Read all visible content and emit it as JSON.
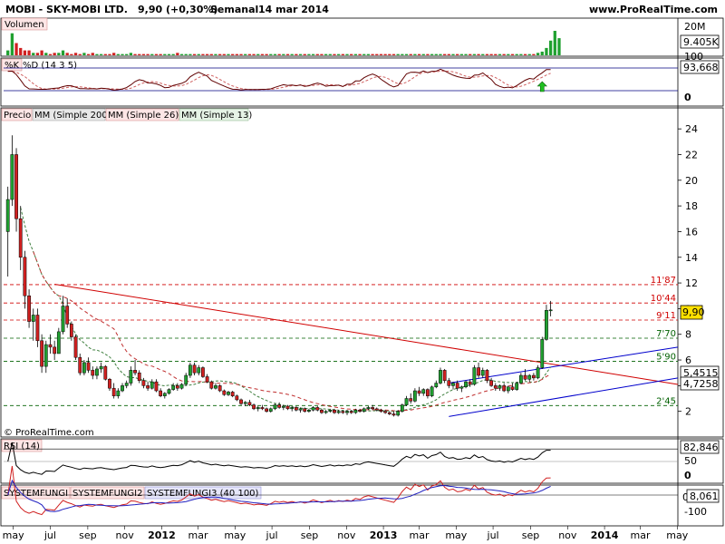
{
  "header": {
    "ticker": "MOBI - SKY-MOBI LTD.",
    "price_change": "9,90 (+0,30%)",
    "period": "Semanal",
    "date": "14 mar 2014",
    "site": "www.ProRealTime.com"
  },
  "colors": {
    "up": "#20a030",
    "down": "#d02020",
    "resistance": "#d00000",
    "support": "#006000",
    "channel": "#0000cc",
    "sma200": "#555555",
    "sma26": "#c03030",
    "sma13": "#408040"
  },
  "volume_panel": {
    "title": "Volumen",
    "axis_labels": [
      "20M",
      "9.405K"
    ]
  },
  "stoch_panel": {
    "k_label": "%K",
    "d_label": "%D (14 3 5)",
    "axis_labels": [
      "100",
      "93,668",
      "0"
    ],
    "arrow_icon": "up-arrow-icon"
  },
  "price_panel": {
    "legend": [
      "Precio",
      "MM (Simple 200)",
      "MM (Simple 26)",
      "MM (Simple 13)"
    ],
    "copyright": "© ProRealTime.com",
    "level_labels": [
      "11'87",
      "10'44",
      "9'11",
      "7'70",
      "5'90",
      "2'45"
    ],
    "current_price": "9,90",
    "sma_13_value": "5,4515",
    "sma_26_value": "4,7258"
  },
  "rsi_panel": {
    "title": "RSI (14)",
    "axis_labels": [
      "82,846",
      "50",
      "0"
    ]
  },
  "sf_panel": {
    "titles": [
      "SYSTEMFUNGI",
      "SYSTEMFUNGI2",
      "SYSTEMFUNGI3 (40 100)"
    ],
    "axis_labels": [
      "0",
      "8,061",
      "-100"
    ]
  },
  "x_axis": {
    "labels": [
      "may",
      "jul",
      "sep",
      "nov",
      "2012",
      "mar",
      "may",
      "jul",
      "sep",
      "nov",
      "2013",
      "mar",
      "may",
      "jul",
      "sep",
      "nov",
      "2014",
      "mar",
      "may"
    ]
  },
  "chart_data": {
    "type": "candlestick",
    "frequency": "Semanal",
    "y_axis_ticks": [
      2,
      4,
      6,
      8,
      10,
      12,
      14,
      16,
      18,
      20,
      22,
      24
    ],
    "ylim": [
      0,
      25
    ],
    "xlim": [
      "2011-05-06",
      "2014-05-23"
    ],
    "horizontal_levels": [
      {
        "label": "11'87",
        "value": 11.87,
        "style": "resistance"
      },
      {
        "label": "10'44",
        "value": 10.44,
        "style": "resistance"
      },
      {
        "label": "9'11",
        "value": 9.11,
        "style": "resistance"
      },
      {
        "label": "7'70",
        "value": 7.7,
        "style": "support"
      },
      {
        "label": "5'90",
        "value": 5.9,
        "style": "support"
      },
      {
        "label": "2'45",
        "value": 2.45,
        "style": "support"
      }
    ],
    "trendlines": [
      {
        "name": "",
        "from": {
          "date": "2011-07-29",
          "value": 11.9
        },
        "to": {
          "date": "2014-05-23",
          "value": 4.1
        },
        "color": "resistance"
      },
      {
        "name": "",
        "from": {
          "date": "2013-05-10",
          "value": 4.2
        },
        "to": {
          "date": "2014-05-23",
          "value": 7.0
        },
        "color": "channel"
      },
      {
        "name": "",
        "from": {
          "date": "2013-05-10",
          "value": 1.6
        },
        "to": {
          "date": "2014-05-23",
          "value": 4.6
        },
        "color": "channel"
      }
    ],
    "candles": [
      {
        "o": 16.0,
        "h": 19.5,
        "l": 12.5,
        "c": 18.5
      },
      {
        "o": 18.5,
        "h": 23.5,
        "l": 18.0,
        "c": 22.0
      },
      {
        "o": 22.0,
        "h": 22.5,
        "l": 16.0,
        "c": 17.0
      },
      {
        "o": 17.0,
        "h": 18.0,
        "l": 13.0,
        "c": 14.0
      },
      {
        "o": 14.0,
        "h": 14.5,
        "l": 10.0,
        "c": 11.0
      },
      {
        "o": 11.0,
        "h": 11.5,
        "l": 8.5,
        "c": 9.0
      },
      {
        "o": 9.0,
        "h": 10.0,
        "l": 7.5,
        "c": 9.5
      },
      {
        "o": 9.5,
        "h": 10.0,
        "l": 7.0,
        "c": 7.5
      },
      {
        "o": 7.5,
        "h": 8.0,
        "l": 5.0,
        "c": 5.5
      },
      {
        "o": 5.5,
        "h": 7.5,
        "l": 5.0,
        "c": 7.2
      },
      {
        "o": 7.2,
        "h": 8.0,
        "l": 6.5,
        "c": 7.0
      },
      {
        "o": 7.0,
        "h": 7.5,
        "l": 6.0,
        "c": 6.5
      },
      {
        "o": 6.5,
        "h": 8.5,
        "l": 6.5,
        "c": 8.2
      },
      {
        "o": 8.2,
        "h": 11.0,
        "l": 8.0,
        "c": 10.2
      },
      {
        "o": 10.2,
        "h": 10.8,
        "l": 8.5,
        "c": 8.8
      },
      {
        "o": 8.8,
        "h": 9.0,
        "l": 7.5,
        "c": 7.8
      },
      {
        "o": 7.8,
        "h": 8.0,
        "l": 6.0,
        "c": 6.2
      },
      {
        "o": 6.2,
        "h": 6.5,
        "l": 4.8,
        "c": 5.0
      },
      {
        "o": 5.0,
        "h": 6.0,
        "l": 4.8,
        "c": 5.8
      },
      {
        "o": 5.8,
        "h": 6.2,
        "l": 5.0,
        "c": 5.2
      },
      {
        "o": 5.2,
        "h": 5.5,
        "l": 4.5,
        "c": 4.8
      },
      {
        "o": 4.8,
        "h": 5.5,
        "l": 4.5,
        "c": 5.3
      },
      {
        "o": 5.3,
        "h": 5.8,
        "l": 5.0,
        "c": 5.5
      },
      {
        "o": 5.5,
        "h": 5.6,
        "l": 4.4,
        "c": 4.5
      },
      {
        "o": 4.5,
        "h": 4.6,
        "l": 3.6,
        "c": 3.8
      },
      {
        "o": 3.8,
        "h": 4.2,
        "l": 3.0,
        "c": 3.2
      },
      {
        "o": 3.2,
        "h": 3.8,
        "l": 3.0,
        "c": 3.6
      },
      {
        "o": 3.6,
        "h": 4.2,
        "l": 3.5,
        "c": 4.0
      },
      {
        "o": 4.0,
        "h": 4.4,
        "l": 3.8,
        "c": 4.2
      },
      {
        "o": 4.2,
        "h": 5.5,
        "l": 4.0,
        "c": 5.2
      },
      {
        "o": 5.2,
        "h": 6.0,
        "l": 4.8,
        "c": 5.0
      },
      {
        "o": 5.0,
        "h": 5.2,
        "l": 4.2,
        "c": 4.4
      },
      {
        "o": 4.4,
        "h": 4.6,
        "l": 3.8,
        "c": 4.0
      },
      {
        "o": 4.0,
        "h": 4.3,
        "l": 3.6,
        "c": 3.8
      },
      {
        "o": 3.8,
        "h": 4.5,
        "l": 3.7,
        "c": 4.3
      },
      {
        "o": 4.3,
        "h": 4.5,
        "l": 3.5,
        "c": 3.6
      },
      {
        "o": 3.6,
        "h": 3.8,
        "l": 3.1,
        "c": 3.2
      },
      {
        "o": 3.2,
        "h": 3.5,
        "l": 3.0,
        "c": 3.4
      },
      {
        "o": 3.4,
        "h": 3.8,
        "l": 3.3,
        "c": 3.7
      },
      {
        "o": 3.7,
        "h": 4.2,
        "l": 3.6,
        "c": 4.0
      },
      {
        "o": 4.0,
        "h": 4.2,
        "l": 3.6,
        "c": 3.8
      },
      {
        "o": 3.8,
        "h": 4.2,
        "l": 3.7,
        "c": 4.1
      },
      {
        "o": 4.1,
        "h": 5.0,
        "l": 4.0,
        "c": 4.8
      },
      {
        "o": 4.8,
        "h": 5.8,
        "l": 4.6,
        "c": 5.6
      },
      {
        "o": 5.6,
        "h": 5.8,
        "l": 4.8,
        "c": 5.0
      },
      {
        "o": 5.0,
        "h": 5.6,
        "l": 4.8,
        "c": 5.4
      },
      {
        "o": 5.4,
        "h": 5.5,
        "l": 4.6,
        "c": 4.7
      },
      {
        "o": 4.7,
        "h": 4.9,
        "l": 4.2,
        "c": 4.3
      },
      {
        "o": 4.3,
        "h": 4.4,
        "l": 3.7,
        "c": 3.8
      },
      {
        "o": 3.8,
        "h": 4.2,
        "l": 3.7,
        "c": 4.0
      },
      {
        "o": 4.0,
        "h": 4.1,
        "l": 3.5,
        "c": 3.6
      },
      {
        "o": 3.6,
        "h": 3.7,
        "l": 3.2,
        "c": 3.3
      },
      {
        "o": 3.3,
        "h": 3.6,
        "l": 3.2,
        "c": 3.5
      },
      {
        "o": 3.5,
        "h": 3.6,
        "l": 3.1,
        "c": 3.2
      },
      {
        "o": 3.2,
        "h": 3.3,
        "l": 2.8,
        "c": 2.9
      },
      {
        "o": 2.9,
        "h": 3.0,
        "l": 2.5,
        "c": 2.6
      },
      {
        "o": 2.6,
        "h": 2.8,
        "l": 2.4,
        "c": 2.7
      },
      {
        "o": 2.7,
        "h": 2.9,
        "l": 2.4,
        "c": 2.5
      },
      {
        "o": 2.5,
        "h": 2.6,
        "l": 2.1,
        "c": 2.2
      },
      {
        "o": 2.2,
        "h": 2.4,
        "l": 2.0,
        "c": 2.3
      },
      {
        "o": 2.3,
        "h": 2.5,
        "l": 2.1,
        "c": 2.2
      },
      {
        "o": 2.2,
        "h": 2.3,
        "l": 1.9,
        "c": 2.0
      },
      {
        "o": 2.0,
        "h": 2.3,
        "l": 1.9,
        "c": 2.2
      },
      {
        "o": 2.2,
        "h": 2.6,
        "l": 2.1,
        "c": 2.5
      },
      {
        "o": 2.5,
        "h": 2.7,
        "l": 2.2,
        "c": 2.3
      },
      {
        "o": 2.3,
        "h": 2.5,
        "l": 2.1,
        "c": 2.4
      },
      {
        "o": 2.4,
        "h": 2.5,
        "l": 2.1,
        "c": 2.2
      },
      {
        "o": 2.2,
        "h": 2.4,
        "l": 2.0,
        "c": 2.3
      },
      {
        "o": 2.3,
        "h": 2.4,
        "l": 2.0,
        "c": 2.1
      },
      {
        "o": 2.1,
        "h": 2.3,
        "l": 1.9,
        "c": 2.2
      },
      {
        "o": 2.2,
        "h": 2.3,
        "l": 1.9,
        "c": 2.0
      },
      {
        "o": 2.0,
        "h": 2.2,
        "l": 1.9,
        "c": 2.1
      },
      {
        "o": 2.1,
        "h": 2.4,
        "l": 2.0,
        "c": 2.3
      },
      {
        "o": 2.3,
        "h": 2.4,
        "l": 2.0,
        "c": 2.1
      },
      {
        "o": 2.1,
        "h": 2.2,
        "l": 1.8,
        "c": 1.9
      },
      {
        "o": 1.9,
        "h": 2.1,
        "l": 1.8,
        "c": 2.0
      },
      {
        "o": 2.0,
        "h": 2.2,
        "l": 1.9,
        "c": 2.1
      },
      {
        "o": 2.1,
        "h": 2.2,
        "l": 1.8,
        "c": 1.9
      },
      {
        "o": 1.9,
        "h": 2.1,
        "l": 1.8,
        "c": 2.0
      },
      {
        "o": 2.0,
        "h": 2.1,
        "l": 1.8,
        "c": 1.9
      },
      {
        "o": 1.9,
        "h": 2.1,
        "l": 1.7,
        "c": 2.0
      },
      {
        "o": 2.0,
        "h": 2.1,
        "l": 1.8,
        "c": 1.9
      },
      {
        "o": 1.9,
        "h": 2.2,
        "l": 1.8,
        "c": 2.1
      },
      {
        "o": 2.1,
        "h": 2.2,
        "l": 1.9,
        "c": 2.0
      },
      {
        "o": 2.0,
        "h": 2.3,
        "l": 1.9,
        "c": 2.2
      },
      {
        "o": 2.2,
        "h": 2.4,
        "l": 2.1,
        "c": 2.3
      },
      {
        "o": 2.3,
        "h": 2.5,
        "l": 2.1,
        "c": 2.2
      },
      {
        "o": 2.2,
        "h": 2.3,
        "l": 2.0,
        "c": 2.1
      },
      {
        "o": 2.1,
        "h": 2.2,
        "l": 1.9,
        "c": 2.0
      },
      {
        "o": 2.0,
        "h": 2.1,
        "l": 1.8,
        "c": 1.9
      },
      {
        "o": 1.9,
        "h": 2.0,
        "l": 1.7,
        "c": 1.8
      },
      {
        "o": 1.8,
        "h": 2.0,
        "l": 1.6,
        "c": 1.7
      },
      {
        "o": 1.7,
        "h": 2.1,
        "l": 1.6,
        "c": 2.0
      },
      {
        "o": 2.0,
        "h": 2.6,
        "l": 1.9,
        "c": 2.5
      },
      {
        "o": 2.5,
        "h": 3.2,
        "l": 2.4,
        "c": 3.0
      },
      {
        "o": 3.0,
        "h": 3.4,
        "l": 2.6,
        "c": 2.8
      },
      {
        "o": 2.8,
        "h": 3.8,
        "l": 2.7,
        "c": 3.6
      },
      {
        "o": 3.6,
        "h": 3.9,
        "l": 3.2,
        "c": 3.4
      },
      {
        "o": 3.4,
        "h": 3.8,
        "l": 3.2,
        "c": 3.7
      },
      {
        "o": 3.7,
        "h": 3.8,
        "l": 3.0,
        "c": 3.2
      },
      {
        "o": 3.2,
        "h": 4.0,
        "l": 3.1,
        "c": 3.9
      },
      {
        "o": 3.9,
        "h": 4.4,
        "l": 3.8,
        "c": 4.2
      },
      {
        "o": 4.2,
        "h": 5.4,
        "l": 4.1,
        "c": 5.2
      },
      {
        "o": 5.2,
        "h": 5.3,
        "l": 4.2,
        "c": 4.4
      },
      {
        "o": 4.4,
        "h": 4.6,
        "l": 3.8,
        "c": 4.0
      },
      {
        "o": 4.0,
        "h": 4.3,
        "l": 3.7,
        "c": 4.2
      },
      {
        "o": 4.2,
        "h": 4.4,
        "l": 3.6,
        "c": 3.8
      },
      {
        "o": 3.8,
        "h": 4.0,
        "l": 3.5,
        "c": 3.9
      },
      {
        "o": 3.9,
        "h": 4.4,
        "l": 3.8,
        "c": 4.3
      },
      {
        "o": 4.3,
        "h": 4.5,
        "l": 3.9,
        "c": 4.1
      },
      {
        "o": 4.1,
        "h": 5.6,
        "l": 4.0,
        "c": 5.4
      },
      {
        "o": 5.4,
        "h": 5.8,
        "l": 4.6,
        "c": 4.8
      },
      {
        "o": 4.8,
        "h": 5.4,
        "l": 4.6,
        "c": 5.2
      },
      {
        "o": 5.2,
        "h": 5.3,
        "l": 4.2,
        "c": 4.4
      },
      {
        "o": 4.4,
        "h": 4.6,
        "l": 3.9,
        "c": 4.0
      },
      {
        "o": 4.0,
        "h": 4.2,
        "l": 3.6,
        "c": 3.8
      },
      {
        "o": 3.8,
        "h": 4.1,
        "l": 3.6,
        "c": 4.0
      },
      {
        "o": 4.0,
        "h": 4.2,
        "l": 3.5,
        "c": 3.6
      },
      {
        "o": 3.6,
        "h": 4.0,
        "l": 3.4,
        "c": 3.9
      },
      {
        "o": 3.9,
        "h": 4.2,
        "l": 3.6,
        "c": 3.7
      },
      {
        "o": 3.7,
        "h": 4.3,
        "l": 3.6,
        "c": 4.2
      },
      {
        "o": 4.2,
        "h": 5.0,
        "l": 4.1,
        "c": 4.8
      },
      {
        "o": 4.8,
        "h": 5.3,
        "l": 4.4,
        "c": 4.5
      },
      {
        "o": 4.5,
        "h": 4.9,
        "l": 4.3,
        "c": 4.8
      },
      {
        "o": 4.8,
        "h": 5.0,
        "l": 4.4,
        "c": 4.6
      },
      {
        "o": 4.6,
        "h": 5.6,
        "l": 4.5,
        "c": 5.4
      },
      {
        "o": 5.4,
        "h": 7.8,
        "l": 5.3,
        "c": 7.6
      },
      {
        "o": 7.6,
        "h": 10.3,
        "l": 7.5,
        "c": 9.87
      },
      {
        "o": 9.87,
        "h": 10.6,
        "l": 9.4,
        "c": 9.9
      }
    ],
    "volume_bars_relative": [
      0.2,
      0.9,
      0.5,
      0.3,
      0.2,
      0.2,
      0.1,
      0.1,
      0.2,
      0.1,
      0.05,
      0.1,
      0.1,
      0.2,
      0.1,
      0.05,
      0.1,
      0.05,
      0.1,
      0.05,
      0.1,
      0.05,
      0.05,
      0.05,
      0.05,
      0.1,
      0.05,
      0.05,
      0.05,
      0.1,
      0.05,
      0.05,
      0.05,
      0.05,
      0.05,
      0.05,
      0.05,
      0.05,
      0.05,
      0.05,
      0.1,
      0.05,
      0.05,
      0.05,
      0.05,
      0.05,
      0.05,
      0.05,
      0.05,
      0.05,
      0.05,
      0.05,
      0.05,
      0.05,
      0.05,
      0.05,
      0.05,
      0.05,
      0.05,
      0.05,
      0.05,
      0.05,
      0.05,
      0.05,
      0.05,
      0.05,
      0.05,
      0.05,
      0.05,
      0.05,
      0.05,
      0.05,
      0.05,
      0.05,
      0.05,
      0.05,
      0.05,
      0.05,
      0.05,
      0.05,
      0.05,
      0.05,
      0.05,
      0.05,
      0.05,
      0.05,
      0.05,
      0.05,
      0.05,
      0.05,
      0.05,
      0.05,
      0.05,
      0.05,
      0.05,
      0.05,
      0.05,
      0.05,
      0.05,
      0.05,
      0.05,
      0.05,
      0.05,
      0.05,
      0.05,
      0.05,
      0.05,
      0.05,
      0.05,
      0.05,
      0.05,
      0.05,
      0.05,
      0.05,
      0.05,
      0.05,
      0.05,
      0.05,
      0.05,
      0.05,
      0.05,
      0.05,
      0.05,
      0.05,
      0.05,
      0.1,
      0.15,
      0.3,
      0.6,
      1.0,
      0.7
    ],
    "indicators": {
      "stochastic_last": 93.668,
      "rsi_last": 82.846,
      "systemfungi_last": 8.061
    }
  }
}
